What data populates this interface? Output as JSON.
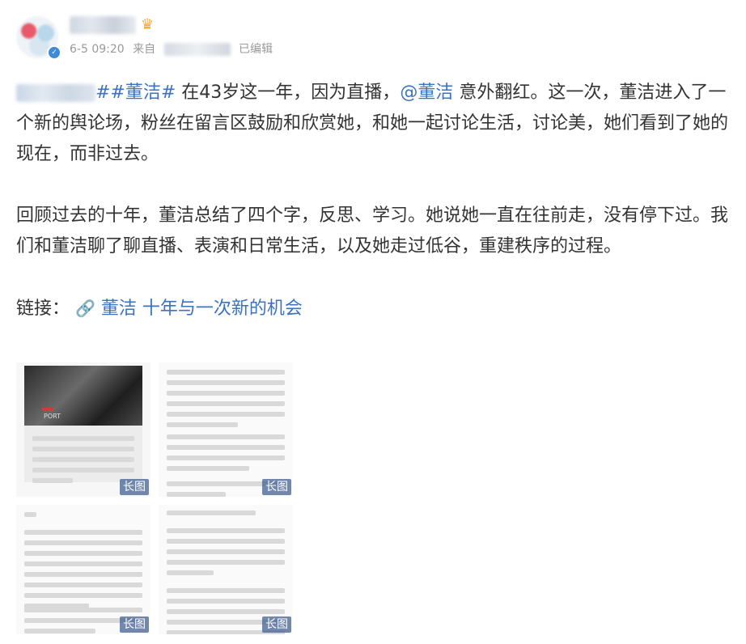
{
  "post": {
    "timestamp": "6-5 09:20",
    "source_prefix": "来自",
    "edited_label": "已编辑",
    "para1_tag": "##董洁#",
    "para1_text1": " 在43岁这一年，因为直播，",
    "para1_mention": "@董洁",
    "para1_text2": " 意外翻红。这一次，董洁进入了一个新的舆论场，粉丝在留言区鼓励和欣赏她，和她一起讨论生活，讨论美，她们看到了她的现在，而非过去。",
    "para2": "回顾过去的十年，董洁总结了四个字，反思、学习。她说她一直在往前走，没有停下过。我们和董洁聊了聊直播、表演和日常生活，以及她走过低谷，重建秩序的过程。",
    "link_prefix": "链接：",
    "link_icon": "link-icon",
    "link_text": "董洁 十年与一次新的机会"
  },
  "images": {
    "long_label": "长图",
    "tiles": [
      "image-1",
      "image-2",
      "image-3",
      "image-4"
    ]
  },
  "colors": {
    "link_blue": "#3b73c2",
    "meta_gray": "#999999"
  }
}
